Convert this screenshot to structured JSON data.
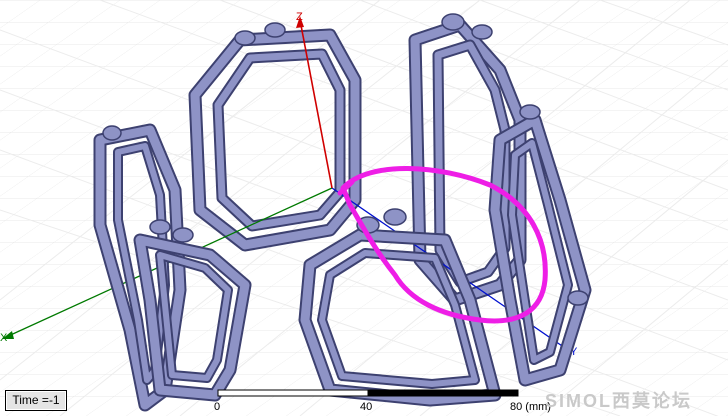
{
  "axes": {
    "x_label": "X",
    "y_label": "Y",
    "z_label": "Z",
    "x_color": "#007a00",
    "y_color": "#0010d0",
    "z_color": "#d00000"
  },
  "model": {
    "coil_fill": "#8e93c6",
    "coil_edge": "#3d4170"
  },
  "annotation": {
    "color": "#ee1ee6",
    "shape": "hand-drawn-loop"
  },
  "status": {
    "time_label": "Time =-1"
  },
  "scale_bar": {
    "ticks": [
      "0",
      "40",
      "80 (mm)"
    ]
  },
  "watermark": {
    "text": "SIMOL西莫论坛"
  }
}
